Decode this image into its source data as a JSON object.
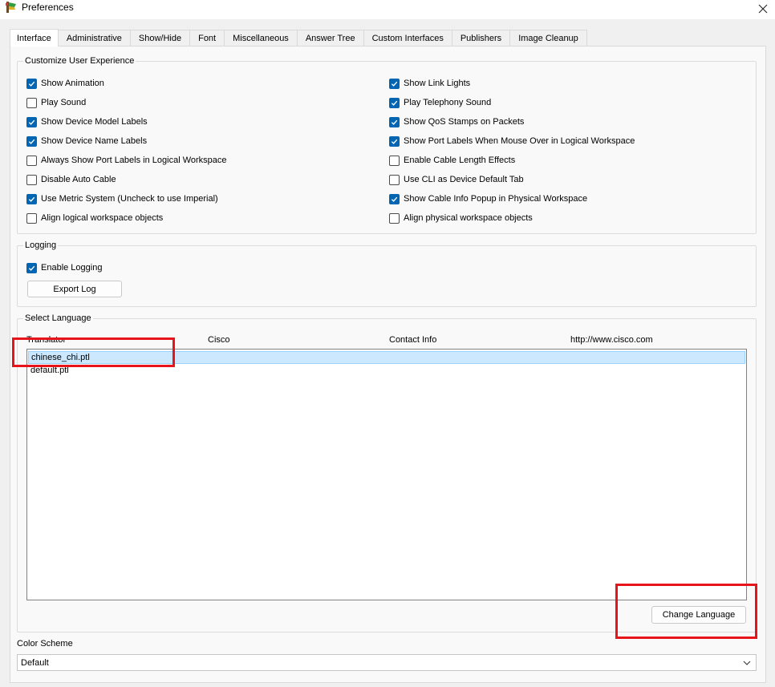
{
  "window": {
    "title": "Preferences"
  },
  "tabs": [
    {
      "label": "Interface",
      "active": true
    },
    {
      "label": "Administrative"
    },
    {
      "label": "Show/Hide"
    },
    {
      "label": "Font"
    },
    {
      "label": "Miscellaneous"
    },
    {
      "label": "Answer Tree"
    },
    {
      "label": "Custom Interfaces"
    },
    {
      "label": "Publishers"
    },
    {
      "label": "Image Cleanup"
    }
  ],
  "customize": {
    "title": "Customize User Experience",
    "left": [
      {
        "label": "Show Animation",
        "checked": true
      },
      {
        "label": "Play Sound",
        "checked": false
      },
      {
        "label": "Show Device Model Labels",
        "checked": true
      },
      {
        "label": "Show Device Name Labels",
        "checked": true
      },
      {
        "label": "Always Show Port Labels in Logical Workspace",
        "checked": false
      },
      {
        "label": "Disable Auto Cable",
        "checked": false
      },
      {
        "label": "Use Metric System (Uncheck to use Imperial)",
        "checked": true
      },
      {
        "label": "Align logical workspace objects",
        "checked": false
      }
    ],
    "right": [
      {
        "label": "Show Link Lights",
        "checked": true
      },
      {
        "label": "Play Telephony Sound",
        "checked": true
      },
      {
        "label": "Show QoS Stamps on Packets",
        "checked": true
      },
      {
        "label": "Show Port Labels When Mouse Over in Logical Workspace",
        "checked": true
      },
      {
        "label": "Enable Cable Length Effects",
        "checked": false
      },
      {
        "label": "Use CLI as Device Default Tab",
        "checked": false
      },
      {
        "label": "Show Cable Info Popup in Physical Workspace",
        "checked": true
      },
      {
        "label": "Align physical workspace objects",
        "checked": false
      }
    ]
  },
  "logging": {
    "title": "Logging",
    "enable_label": "Enable Logging",
    "enable_checked": true,
    "export_button": "Export Log"
  },
  "language": {
    "title": "Select Language",
    "header": {
      "translator": "Translator",
      "company": "Cisco",
      "contact": "Contact Info",
      "url": "http://www.cisco.com"
    },
    "files": [
      {
        "name": "chinese_chi.ptl",
        "selected": true
      },
      {
        "name": "default.ptl",
        "selected": false
      }
    ],
    "change_button": "Change Language"
  },
  "color_scheme": {
    "label": "Color Scheme",
    "value": "Default"
  },
  "colors": {
    "accent": "#0066b4",
    "highlight": "#e8141c",
    "selection": "#cce8ff"
  }
}
